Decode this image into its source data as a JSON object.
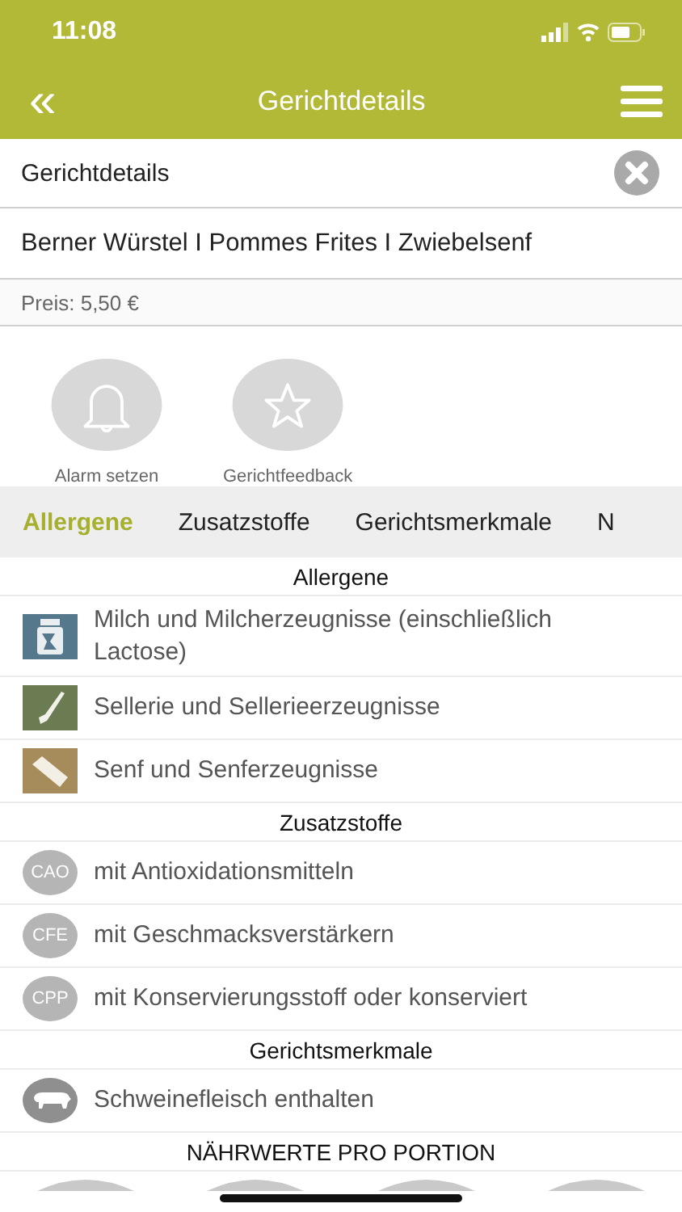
{
  "status_bar": {
    "time": "11:08"
  },
  "header": {
    "back": "«",
    "title": "Gerichtdetails"
  },
  "detail_bar": {
    "title": "Gerichtdetails"
  },
  "dish": {
    "name": "Berner Würstel I Pommes Frites I Zwiebelsenf",
    "price": "Preis: 5,50 €"
  },
  "actions": [
    {
      "kind": "bell",
      "label": "Alarm setzen"
    },
    {
      "kind": "star",
      "label": "Gerichtfeedback"
    }
  ],
  "tabs": [
    {
      "label": "Allergene",
      "selected": true
    },
    {
      "label": "Zusatzstoffe",
      "selected": false
    },
    {
      "label": "Gerichtsmerkmale",
      "selected": false
    },
    {
      "label": "N",
      "selected": false
    }
  ],
  "sections": [
    {
      "title": "Allergene",
      "items": [
        {
          "kind": "milk",
          "text": "Milch und Milcherzeugnisse (einschließlich Lactose)"
        },
        {
          "kind": "celery",
          "text": "Sellerie und Sellerieerzeugnisse"
        },
        {
          "kind": "mustard",
          "text": "Senf und Senferzeugnisse"
        }
      ]
    },
    {
      "title": "Zusatzstoffe",
      "items": [
        {
          "kind": "badge",
          "badge": "CAO",
          "text": "mit Antioxidationsmitteln"
        },
        {
          "kind": "badge",
          "badge": "CFE",
          "text": "mit Geschmacksverstärkern"
        },
        {
          "kind": "badge",
          "badge": "CPP",
          "text": "mit Konservierungsstoff oder konserviert"
        }
      ]
    },
    {
      "title": "Gerichtsmerkmale",
      "items": [
        {
          "kind": "pig",
          "text": "Schweinefleisch enthalten"
        }
      ]
    },
    {
      "title": "NÄHRWERTE PRO PORTION"
    }
  ]
}
